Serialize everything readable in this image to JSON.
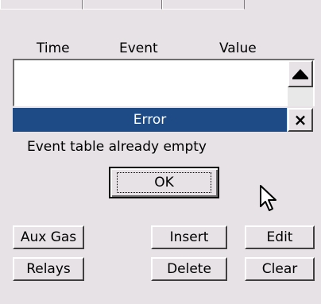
{
  "table": {
    "columns": [
      "Time",
      "Event",
      "Value"
    ]
  },
  "error": {
    "title": "Error",
    "message": "Event table already empty",
    "ok_label": "OK",
    "close_glyph": "×",
    "accent_color": "#1e4a86"
  },
  "scrollbar": {
    "up_arrow": "▲"
  },
  "buttons": {
    "aux_gas": "Aux Gas",
    "relays": "Relays",
    "insert": "Insert",
    "delete": "Delete",
    "edit": "Edit",
    "clear": "Clear"
  },
  "icons": {
    "close": "close-icon",
    "scroll_up": "triangle-up-icon",
    "cursor": "mouse-pointer-icon"
  }
}
